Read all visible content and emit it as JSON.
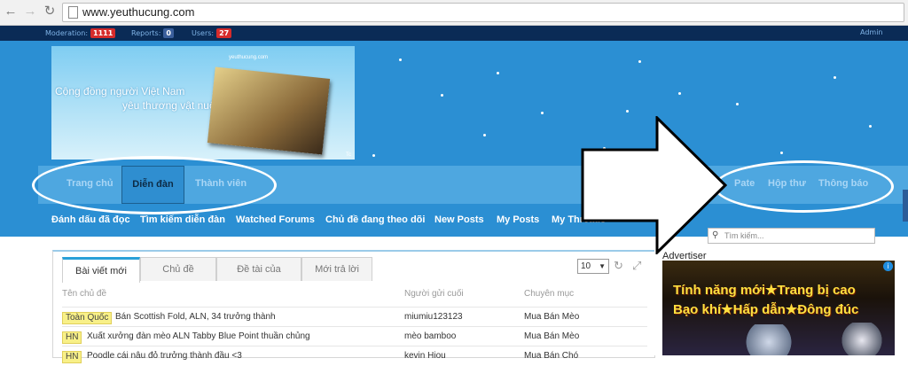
{
  "browser": {
    "url": "www.yeuthucung.com",
    "back_icon": "back-arrow-icon",
    "forward_icon": "forward-arrow-icon",
    "reload_icon": "reload-icon"
  },
  "adminbar": {
    "moderation_label": "Moderation:",
    "moderation_count": "1111",
    "reports_label": "Reports:",
    "reports_count": "0",
    "users_label": "Users:",
    "users_count": "27",
    "admin_label": "Admin"
  },
  "banner": {
    "line1": "Cộng đồng người Việt Nam",
    "line2": "yêu thương vật nuôi",
    "brand": "yeuthucung.com",
    "corner": "Tc"
  },
  "nav": {
    "tabs": [
      "Trang chủ",
      "Diễn đàn",
      "Thành viên"
    ],
    "right_tabs": [
      "Pate",
      "Hộp thư",
      "Thông báo"
    ]
  },
  "subnav": [
    "Đánh dấu đã đọc",
    "Tìm kiếm diễn đàn",
    "Watched Forums",
    "Chủ đề đang theo dõi",
    "New Posts",
    "My Posts",
    "My Threads"
  ],
  "panel": {
    "tabs": [
      "Bài viết mới",
      "Chủ đề",
      "Đề tài của",
      "Mới trả lời"
    ],
    "select_value": "10",
    "columns": [
      "Tên chủ đề",
      "Người gửi cuối",
      "Chuyên mục"
    ],
    "rows": [
      {
        "tag": "Toàn Quốc",
        "title": "Bán Scottish Fold, ALN, 34 trưởng thành",
        "poster": "miumiu123123",
        "category": "Mua Bán Mèo"
      },
      {
        "tag": "HN",
        "title": "Xuất xưởng đàn mèo ALN Tabby Blue Point thuần chủng",
        "poster": "mèo bamboo",
        "category": "Mua Bán Mèo"
      },
      {
        "tag": "HN",
        "title": "Poodle cái nâu đỏ trưởng thành đầu <3",
        "poster": "kevin Hiou",
        "category": "Mua Bán Chó"
      }
    ]
  },
  "sidebar": {
    "search_placeholder": "Tìm kiếm...",
    "ad_label": "Advertiser",
    "ad_line1": "Tính năng mới★Trang bị cao",
    "ad_line2": "Bạo khí★Hấp dẫn★Đông đúc"
  },
  "colors": {
    "header_bg": "#2b8fd3",
    "nav_bg": "#4ea7e0",
    "adminbar_bg": "#0a2b56",
    "badge_red": "#d62b2b",
    "badge_blue": "#3a5f9c"
  }
}
